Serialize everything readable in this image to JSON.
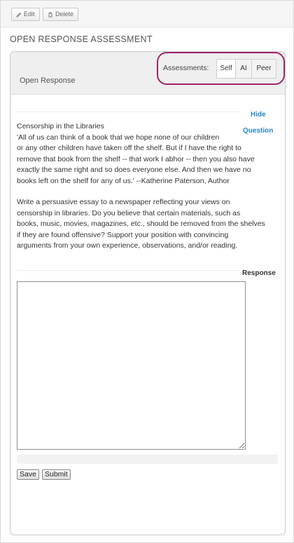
{
  "toolbar": {
    "edit_label": "Edit",
    "delete_label": "Delete"
  },
  "page": {
    "title": "OPEN RESPONSE ASSESSMENT"
  },
  "card": {
    "title": "Open Response",
    "assessments_label": "Assessments:",
    "assessment_options": [
      "Self",
      "AI",
      "Peer"
    ],
    "selected_assessment": "Self"
  },
  "question": {
    "hide_label": "Hide",
    "question_label": "Question",
    "lines": [
      "Censorship in the Libraries",
      "'All of us can think of a book that we hope none of our children",
      "or any other children have taken off the shelf. But if I have the right to",
      "remove that book from the shelf -- that work I abhor -- then you also have",
      "exactly the same right and so does everyone else. And then we have no",
      "books left on the shelf for any of us.' --Katherine Paterson, Author"
    ],
    "prompt_lines": [
      "Write a persuasive essay to a newspaper reflecting your views on",
      "censorship in libraries. Do you believe that certain materials, such as",
      "books, music, movies, magazines, etc., should be removed from the shelves",
      "if they are found offensive? Support your position with convincing",
      "arguments from your own experience, observations, and/or reading."
    ]
  },
  "response": {
    "label": "Response",
    "value": ""
  },
  "actions": {
    "save_label": "Save",
    "submit_label": "Submit"
  },
  "colors": {
    "highlight": "#a3236a",
    "link": "#2a87c8"
  }
}
